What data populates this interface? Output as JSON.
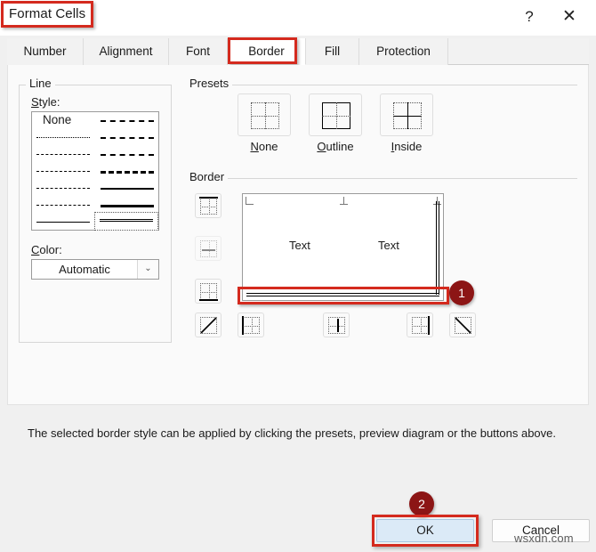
{
  "window": {
    "title": "Format Cells",
    "help_icon": "question-mark-icon",
    "close_icon": "close-icon",
    "help_glyph": "?",
    "close_glyph": "✕"
  },
  "tabs": [
    {
      "label": "Number",
      "active": false
    },
    {
      "label": "Alignment",
      "active": false
    },
    {
      "label": "Font",
      "active": false
    },
    {
      "label": "Border",
      "active": true
    },
    {
      "label": "Fill",
      "active": false
    },
    {
      "label": "Protection",
      "active": false
    }
  ],
  "line_group": {
    "legend": "Line",
    "style_label": "Style:",
    "none_label": "None",
    "styles": [
      {
        "id": "none",
        "column": 0,
        "row": 0,
        "class": "none"
      },
      {
        "id": "dotted-fine",
        "column": 0,
        "row": 1,
        "class": "l-dotted-fine"
      },
      {
        "id": "dotted",
        "column": 0,
        "row": 2,
        "class": "l-dotted"
      },
      {
        "id": "dash-dot-small",
        "column": 0,
        "row": 3,
        "class": "l-dashdot-sm"
      },
      {
        "id": "dash-dot",
        "column": 0,
        "row": 4,
        "class": "l-dash-lg"
      },
      {
        "id": "dashed",
        "column": 0,
        "row": 5,
        "class": "l-dash-med"
      },
      {
        "id": "thin-solid",
        "column": 0,
        "row": 6,
        "class": "l-thin"
      },
      {
        "id": "dash-dot-dot-bold",
        "column": 1,
        "row": 0,
        "class": "l-dashdotdot-b"
      },
      {
        "id": "slanted-dash",
        "column": 1,
        "row": 1,
        "class": "l-slantdash"
      },
      {
        "id": "dash-dot-bold",
        "column": 1,
        "row": 2,
        "class": "l-dashdot-b"
      },
      {
        "id": "dashed-bold",
        "column": 1,
        "row": 3,
        "class": "l-dash-b"
      },
      {
        "id": "medium-solid",
        "column": 1,
        "row": 4,
        "class": "l-medium"
      },
      {
        "id": "thick-solid",
        "column": 1,
        "row": 5,
        "class": "l-thick"
      },
      {
        "id": "double",
        "column": 1,
        "row": 6,
        "class": "l-double",
        "selected": true
      }
    ],
    "color_label": "Color:",
    "color_value": "Automatic",
    "color_arrow_icon": "chevron-down-icon",
    "color_arrow_glyph": "⌄"
  },
  "presets": {
    "legend": "Presets",
    "items": [
      {
        "id": "none",
        "label": "None",
        "mnemonic": "N"
      },
      {
        "id": "outline",
        "label": "Outline",
        "mnemonic": "O"
      },
      {
        "id": "inside",
        "label": "Inside",
        "mnemonic": "I"
      }
    ]
  },
  "border": {
    "legend": "Border",
    "side_buttons": [
      {
        "id": "top",
        "name": "border-top-button",
        "disabled": false
      },
      {
        "id": "horizontal",
        "name": "border-horizontal-button",
        "disabled": true
      },
      {
        "id": "bottom",
        "name": "border-bottom-button",
        "disabled": false
      },
      {
        "id": "diagonal-up",
        "name": "border-diagonal-up-button",
        "disabled": false
      },
      {
        "id": "left",
        "name": "border-left-button",
        "disabled": false
      },
      {
        "id": "vertical",
        "name": "border-vertical-button",
        "disabled": false
      },
      {
        "id": "right",
        "name": "border-right-button",
        "disabled": false
      },
      {
        "id": "diagonal-down",
        "name": "border-diagonal-down-button",
        "disabled": false
      }
    ],
    "preview": {
      "text_left": "Text",
      "text_right": "Text",
      "applied": [
        "right-double",
        "bottom-double"
      ]
    }
  },
  "hint": "The selected border style can be applied by clicking the presets, preview diagram or the buttons above.",
  "footer": {
    "ok_label": "OK",
    "cancel_label": "Cancel"
  },
  "annotations": {
    "badge_1": "1",
    "badge_2": "2",
    "highlight_color": "#d42a1e",
    "badge_color": "#8c1515"
  },
  "watermark": "wsxdn.com"
}
